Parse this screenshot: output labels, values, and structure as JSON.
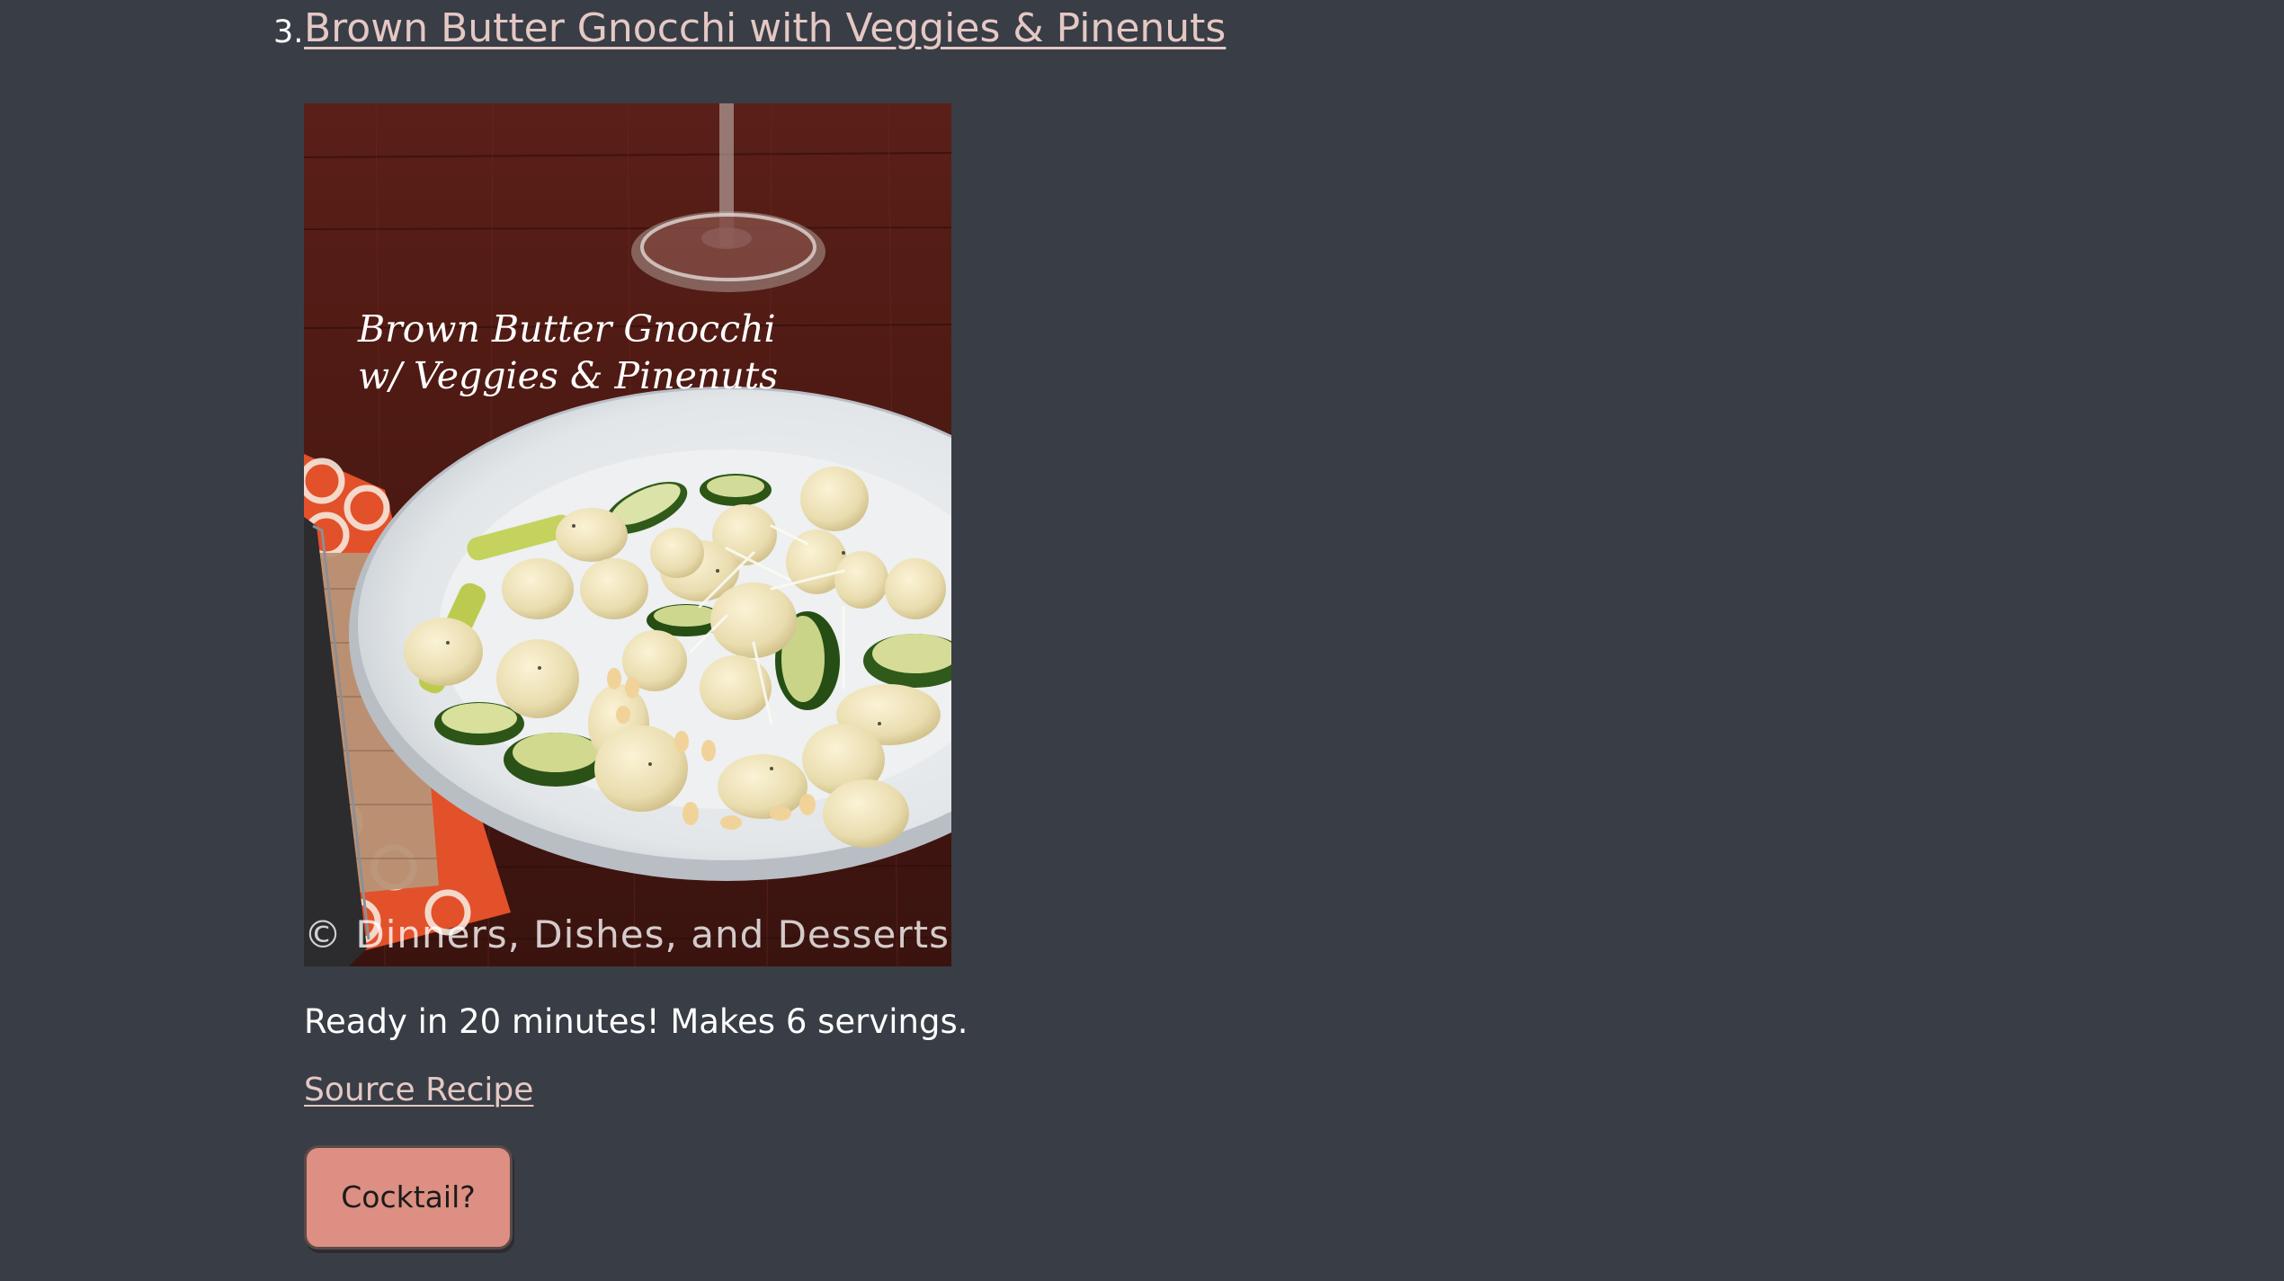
{
  "recipe": {
    "number": "3.",
    "title": "Brown Butter Gnocchi with Veggies & Pinenuts",
    "image": {
      "caption_line1": "Brown Butter Gnocchi",
      "caption_line2": "w/ Veggies & Pinenuts",
      "watermark": "© Dinners, Dishes, and Desserts"
    },
    "summary": "Ready in 20 minutes! Makes 6 servings.",
    "source_link_label": "Source Recipe",
    "cocktail_button_label": "Cocktail?"
  },
  "colors": {
    "page_background": "#393d45",
    "link": "#e4c8c4",
    "button_background": "#dc8f82"
  }
}
